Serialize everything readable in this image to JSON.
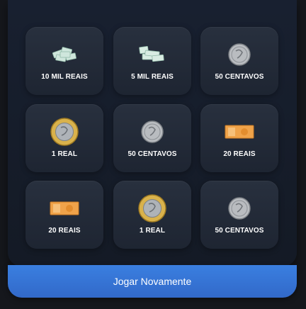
{
  "grid": {
    "cards": [
      {
        "label": "10 MIL REAIS",
        "icon": "banknote-stack-icon"
      },
      {
        "label": "5 MIL REAIS",
        "icon": "banknote-pile-icon"
      },
      {
        "label": "50 CENTAVOS",
        "icon": "silver-coin-icon"
      },
      {
        "label": "1 REAL",
        "icon": "bimetal-coin-icon"
      },
      {
        "label": "50 CENTAVOS",
        "icon": "silver-coin-icon"
      },
      {
        "label": "20 REAIS",
        "icon": "banknote-icon"
      },
      {
        "label": "20 REAIS",
        "icon": "banknote-icon"
      },
      {
        "label": "1 REAL",
        "icon": "bimetal-coin-icon"
      },
      {
        "label": "50 CENTAVOS",
        "icon": "silver-coin-icon"
      }
    ]
  },
  "actions": {
    "play_again_label": "Jogar Novamente"
  },
  "colors": {
    "button": "#3a7fe0",
    "panel": "#182030",
    "card": "#28303e"
  }
}
